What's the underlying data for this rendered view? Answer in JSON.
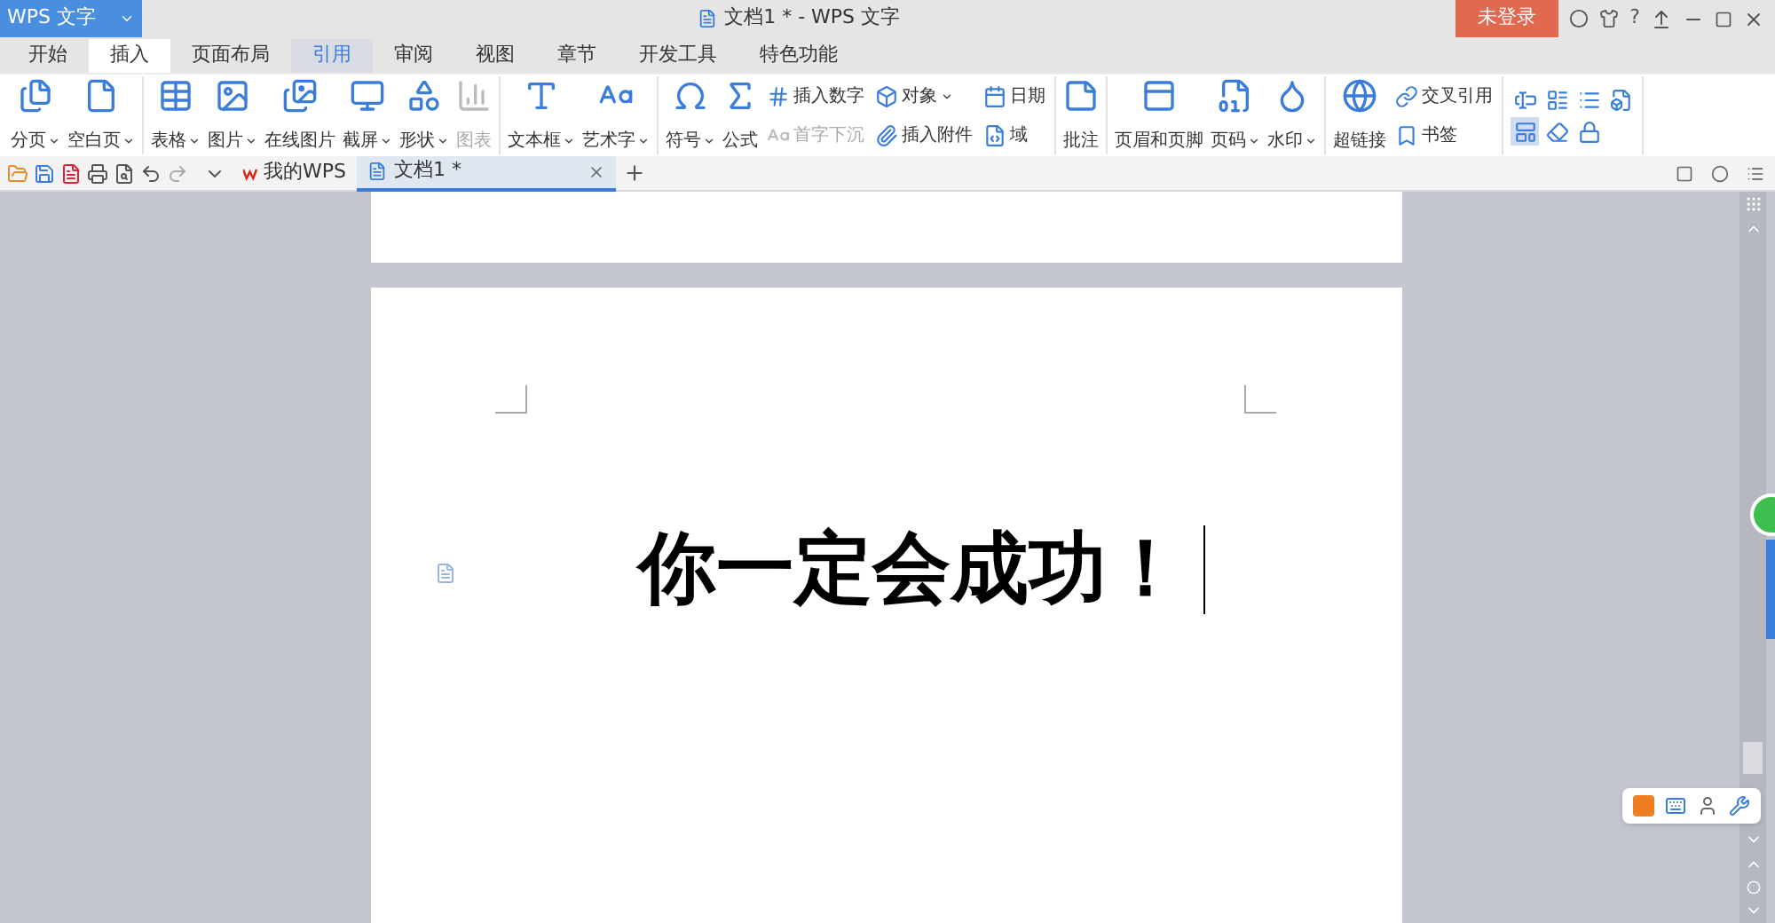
{
  "app_button": {
    "label": "WPS 文字"
  },
  "window": {
    "title": "文档1 * - WPS 文字"
  },
  "login_button": {
    "label": "未登录"
  },
  "help_button": {
    "label": "?"
  },
  "menu_tabs": [
    {
      "label": "开始",
      "selected": false,
      "hovered": false
    },
    {
      "label": "插入",
      "selected": true,
      "hovered": false
    },
    {
      "label": "页面布局",
      "selected": false,
      "hovered": false
    },
    {
      "label": "引用",
      "selected": false,
      "hovered": true
    },
    {
      "label": "审阅",
      "selected": false,
      "hovered": false
    },
    {
      "label": "视图",
      "selected": false,
      "hovered": false
    },
    {
      "label": "章节",
      "selected": false,
      "hovered": false
    },
    {
      "label": "开发工具",
      "selected": false,
      "hovered": false
    },
    {
      "label": "特色功能",
      "selected": false,
      "hovered": false
    }
  ],
  "ribbon": {
    "groups": [
      {
        "items": [
          {
            "kind": "large",
            "label": "分页",
            "dropdown": true,
            "disabled": false
          },
          {
            "kind": "large",
            "label": "空白页",
            "dropdown": true,
            "disabled": false
          }
        ]
      },
      {
        "items": [
          {
            "kind": "large",
            "label": "表格",
            "dropdown": true,
            "disabled": false
          },
          {
            "kind": "large",
            "label": "图片",
            "dropdown": true,
            "disabled": false
          },
          {
            "kind": "large",
            "label": "在线图片",
            "dropdown": false,
            "disabled": false
          },
          {
            "kind": "large",
            "label": "截屏",
            "dropdown": true,
            "disabled": false
          },
          {
            "kind": "large",
            "label": "形状",
            "dropdown": true,
            "disabled": false
          },
          {
            "kind": "large",
            "label": "图表",
            "dropdown": false,
            "disabled": true
          }
        ]
      },
      {
        "items": [
          {
            "kind": "large",
            "label": "文本框",
            "dropdown": true,
            "disabled": false
          },
          {
            "kind": "large",
            "label": "艺术字",
            "dropdown": true,
            "disabled": false
          }
        ]
      },
      {
        "items": [
          {
            "kind": "large",
            "label": "符号",
            "dropdown": true,
            "disabled": false
          },
          {
            "kind": "large",
            "label": "公式",
            "dropdown": false,
            "disabled": false
          },
          {
            "kind": "stack",
            "children": [
              {
                "label": "插入数字",
                "dropdown": false,
                "disabled": false
              },
              {
                "label": "首字下沉",
                "dropdown": false,
                "disabled": true
              }
            ]
          },
          {
            "kind": "stack",
            "children": [
              {
                "label": "对象",
                "dropdown": true,
                "disabled": false
              },
              {
                "label": "插入附件",
                "dropdown": false,
                "disabled": false
              }
            ]
          },
          {
            "kind": "stack",
            "children": [
              {
                "label": "日期",
                "dropdown": false,
                "disabled": false
              },
              {
                "label": "域",
                "dropdown": false,
                "disabled": false
              }
            ]
          }
        ]
      },
      {
        "items": [
          {
            "kind": "large",
            "label": "批注",
            "dropdown": false,
            "disabled": false
          }
        ]
      },
      {
        "items": [
          {
            "kind": "large",
            "label": "页眉和页脚",
            "dropdown": false,
            "disabled": false
          },
          {
            "kind": "large",
            "label": "页码",
            "dropdown": true,
            "disabled": false
          },
          {
            "kind": "large",
            "label": "水印",
            "dropdown": true,
            "disabled": false
          }
        ]
      },
      {
        "items": [
          {
            "kind": "large",
            "label": "超链接",
            "dropdown": false,
            "disabled": false
          },
          {
            "kind": "stack",
            "children": [
              {
                "label": "交叉引用",
                "dropdown": false,
                "disabled": false
              },
              {
                "label": "书签",
                "dropdown": false,
                "disabled": false
              }
            ]
          }
        ]
      }
    ],
    "form_tools": [
      {
        "selected": false
      },
      {
        "selected": false
      },
      {
        "selected": false
      },
      {
        "selected": false
      },
      {
        "selected": true
      },
      {
        "selected": false
      },
      {
        "selected": false
      }
    ]
  },
  "doc_tabs": [
    {
      "label": "我的WPS",
      "selected": false,
      "closable": false
    },
    {
      "label": "文档1 *",
      "selected": true,
      "closable": true
    }
  ],
  "document": {
    "text": "你一定会成功！"
  }
}
